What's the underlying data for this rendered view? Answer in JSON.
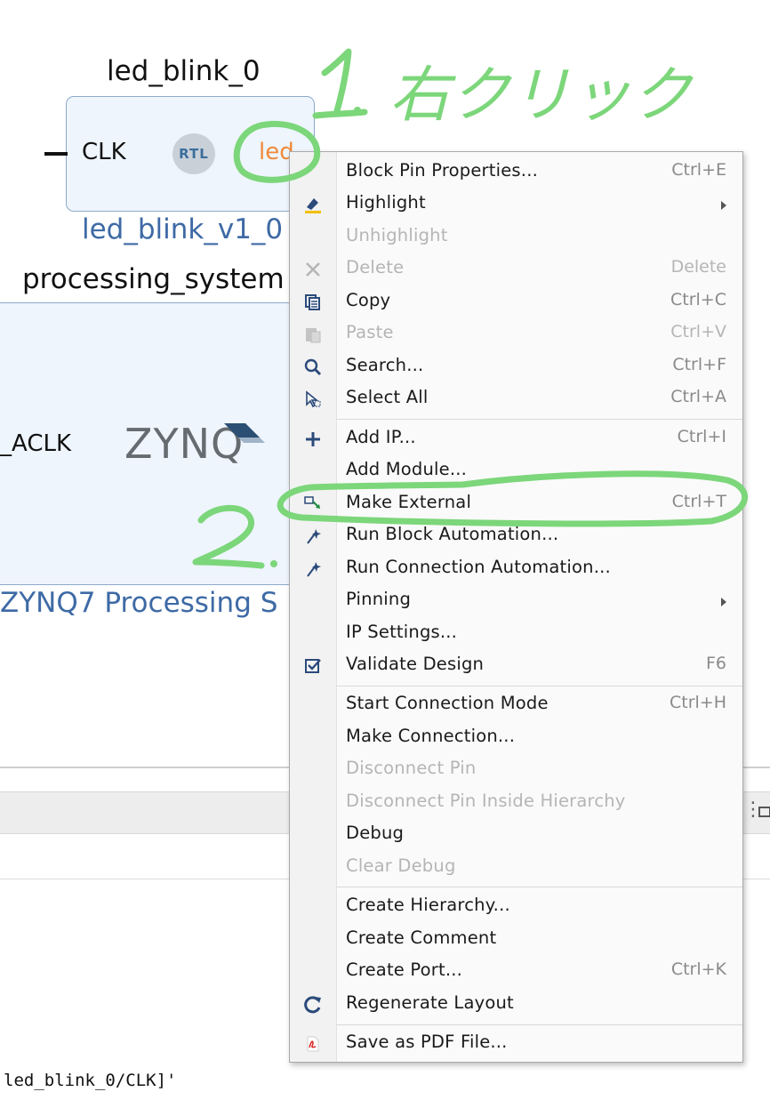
{
  "diagram": {
    "led_block": {
      "instance_name": "led_blink_0",
      "input_pin": "CLK",
      "badge": "RTL",
      "output_pin": "led",
      "type_label": "led_blink_v1_0"
    },
    "zynq_block": {
      "instance_name": "processing_system",
      "pin": "_ACLK",
      "logo_text": "ZYNQ",
      "type_label": "ZYNQ7 Processing S"
    }
  },
  "console": {
    "line": "led_blink_0/CLK]'"
  },
  "annotations": {
    "step1": "1. 右クリック",
    "step2": "2.",
    "color": "#7cd67a"
  },
  "context_menu": {
    "items": [
      {
        "label": "Block Pin Properties...",
        "accel": "Ctrl+E"
      },
      {
        "label": "Highlight",
        "submenu": true
      },
      {
        "label": "Unhighlight",
        "disabled": true
      },
      {
        "label": "Delete",
        "accel": "Delete",
        "disabled": true
      },
      {
        "label": "Copy",
        "accel": "Ctrl+C"
      },
      {
        "label": "Paste",
        "accel": "Ctrl+V",
        "disabled": true
      },
      {
        "label": "Search...",
        "accel": "Ctrl+F"
      },
      {
        "label": "Select All",
        "accel": "Ctrl+A"
      },
      {
        "label": "Add IP...",
        "accel": "Ctrl+I"
      },
      {
        "label": "Add Module..."
      },
      {
        "label": "Make External",
        "accel": "Ctrl+T"
      },
      {
        "label": "Run Block Automation..."
      },
      {
        "label": "Run Connection Automation..."
      },
      {
        "label": "Pinning",
        "submenu": true
      },
      {
        "label": "IP Settings..."
      },
      {
        "label": "Validate Design",
        "accel": "F6"
      },
      {
        "label": "Start Connection Mode",
        "accel": "Ctrl+H"
      },
      {
        "label": "Make Connection..."
      },
      {
        "label": "Disconnect Pin",
        "disabled": true
      },
      {
        "label": "Disconnect Pin Inside Hierarchy",
        "disabled": true
      },
      {
        "label": "Debug"
      },
      {
        "label": "Clear Debug",
        "disabled": true
      },
      {
        "label": "Create Hierarchy..."
      },
      {
        "label": "Create Comment"
      },
      {
        "label": "Create Port...",
        "accel": "Ctrl+K"
      },
      {
        "label": "Regenerate Layout"
      },
      {
        "label": "Save as PDF File..."
      }
    ]
  }
}
